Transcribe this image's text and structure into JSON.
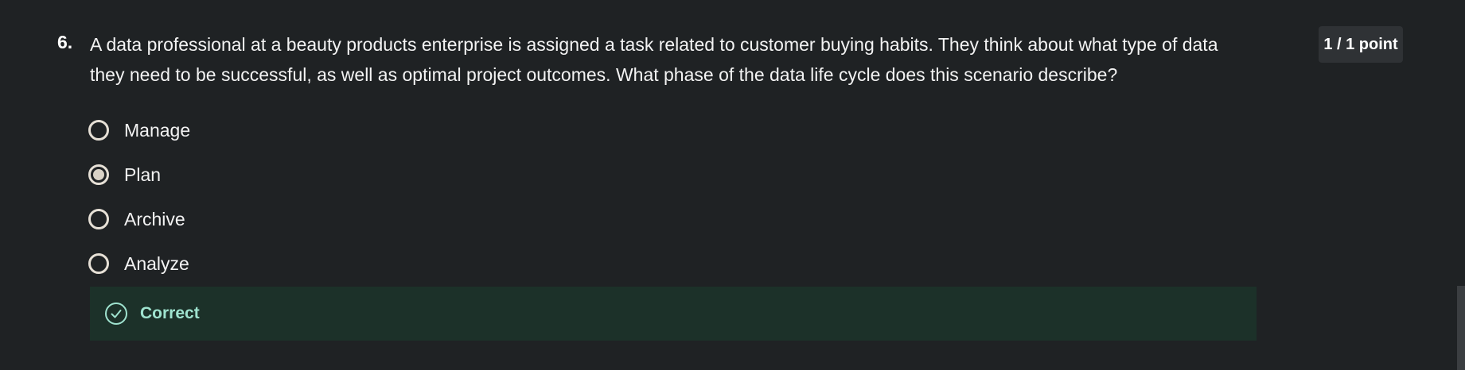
{
  "question": {
    "number": "6.",
    "text": "A data professional at a beauty products enterprise is assigned a task related to customer buying habits. They think about what type of data they need to be successful, as well as optimal project outcomes. What phase of the data life cycle does this scenario describe?",
    "points": "1 / 1 point",
    "options": [
      {
        "label": "Manage",
        "selected": false
      },
      {
        "label": "Plan",
        "selected": true
      },
      {
        "label": "Archive",
        "selected": false
      },
      {
        "label": "Analyze",
        "selected": false
      }
    ],
    "feedback": {
      "label": "Correct",
      "icon": "check-circle-icon",
      "color": "#9fe3cf",
      "background": "#1c3129"
    }
  }
}
